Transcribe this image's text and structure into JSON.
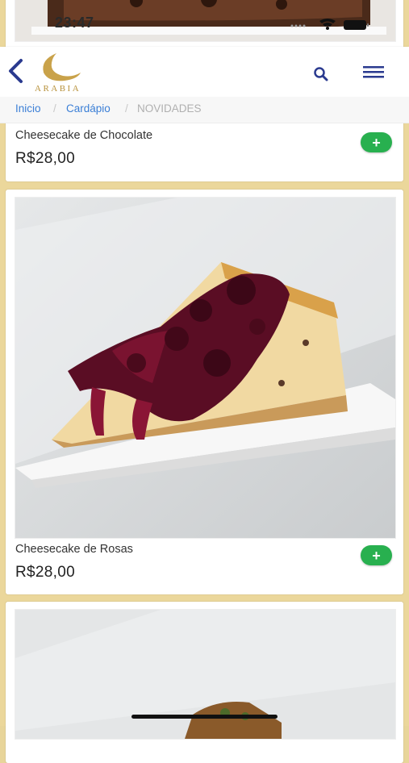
{
  "status_bar": {
    "time": "23:47"
  },
  "header": {
    "logo_text": "ARABIA",
    "brand_color": "#c9a24a",
    "accent_color": "#2a3a8f"
  },
  "breadcrumb": {
    "items": [
      "Inicio",
      "Cardápio",
      "NOVIDADES"
    ],
    "separator": "/"
  },
  "products": [
    {
      "name": "Cheesecake de Chocolate",
      "price": "R$28,00",
      "add_label": "+"
    },
    {
      "name": "Cheesecake de Rosas",
      "price": "R$28,00",
      "add_label": "+"
    }
  ],
  "colors": {
    "background": "#ebd79b",
    "add_button": "#28b04f",
    "link": "#3b7fd6"
  }
}
